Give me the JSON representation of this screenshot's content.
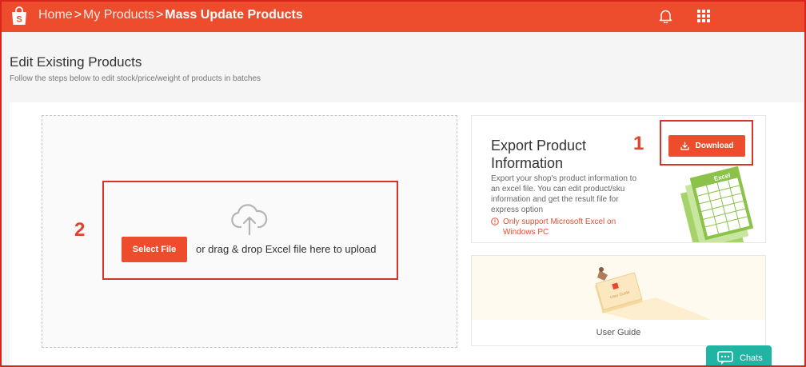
{
  "breadcrumb": {
    "items": [
      "Home",
      "My Products"
    ],
    "current": "Mass Update Products",
    "separator": ">"
  },
  "page": {
    "title": "Edit Existing Products",
    "subtitle": "Follow the steps below to edit stock/price/weight of products in batches"
  },
  "annotations": {
    "step1": "1",
    "step2": "2"
  },
  "upload": {
    "select_label": "Select File",
    "drop_text": "or drag & drop Excel file here to upload",
    "icon": "cloud-upload-icon"
  },
  "export": {
    "title": "Export Product Information",
    "description": "Export your shop's product information to an excel file. You can edit product/sku information and get the result file for express option",
    "warning": "Only support Microsoft Excel on Windows PC",
    "download_label": "Download",
    "art_label": "Excel"
  },
  "guide": {
    "label": "User Guide",
    "art_label": "User Guide"
  },
  "chat": {
    "label": "Chats"
  },
  "colors": {
    "brand": "#ee4d2d",
    "annotation": "#d6342a",
    "chat": "#1fb5a2",
    "excel": "#8bc34a"
  }
}
